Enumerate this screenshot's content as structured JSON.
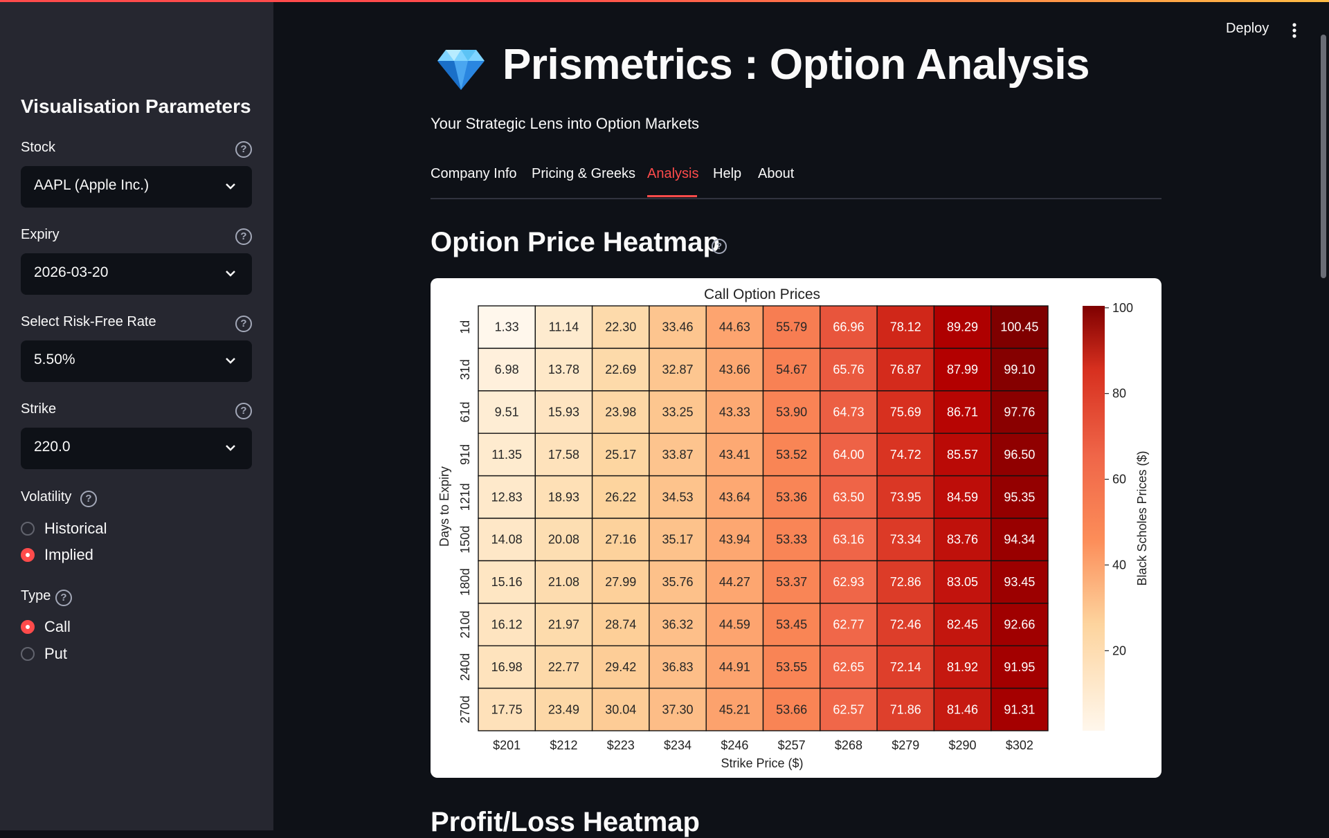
{
  "sidebar": {
    "title": "Visualisation Parameters",
    "stock": {
      "label": "Stock",
      "value": "AAPL (Apple Inc.)"
    },
    "expiry": {
      "label": "Expiry",
      "value": "2026-03-20"
    },
    "risk_free": {
      "label": "Select Risk-Free Rate",
      "value": "5.50%"
    },
    "strike": {
      "label": "Strike",
      "value": "220.0"
    },
    "volatility": {
      "label": "Volatility",
      "options": [
        "Historical",
        "Implied"
      ],
      "selected": "Implied"
    },
    "type": {
      "label": "Type",
      "options": [
        "Call",
        "Put"
      ],
      "selected": "Call"
    }
  },
  "header": {
    "deploy": "Deploy"
  },
  "main": {
    "title": "Prismetrics : Option Analysis",
    "subtitle": "Your Strategic Lens into Option Markets",
    "tabs": [
      {
        "label": "Company Info"
      },
      {
        "label": "Pricing & Greeks"
      },
      {
        "label": "Analysis"
      },
      {
        "label": "Help"
      },
      {
        "label": "About"
      }
    ],
    "active_tab": "Analysis",
    "section1_title": "Option Price Heatmap",
    "section2_title": "Profit/Loss Heatmap"
  },
  "colors": {
    "accent": "#ff4b4b",
    "sidebar_bg": "#262730",
    "main_bg": "#0e1117"
  },
  "icons": {
    "logo": "gem-icon",
    "help": "question-circle-icon",
    "select": "chevron-down-icon",
    "menu": "kebab-menu-icon"
  },
  "chart_data": {
    "type": "heatmap",
    "title": "Call Option Prices",
    "xlabel": "Strike Price ($)",
    "ylabel": "Days to Expiry",
    "colorbar_label": "Black Scholes Prices ($)",
    "colorbar_ticks": [
      20,
      40,
      60,
      80,
      100
    ],
    "colorbar_range": [
      1.33,
      100.45
    ],
    "colormap": "OrRd",
    "x": [
      "$201",
      "$212",
      "$223",
      "$234",
      "$246",
      "$257",
      "$268",
      "$279",
      "$290",
      "$302"
    ],
    "y": [
      "1d",
      "31d",
      "61d",
      "91d",
      "121d",
      "150d",
      "180d",
      "210d",
      "240d",
      "270d"
    ],
    "values": [
      [
        1.33,
        11.14,
        22.3,
        33.46,
        44.63,
        55.79,
        66.96,
        78.12,
        89.29,
        100.45
      ],
      [
        6.98,
        13.78,
        22.69,
        32.87,
        43.66,
        54.67,
        65.76,
        76.87,
        87.99,
        99.1
      ],
      [
        9.51,
        15.93,
        23.98,
        33.25,
        43.33,
        53.9,
        64.73,
        75.69,
        86.71,
        97.76
      ],
      [
        11.35,
        17.58,
        25.17,
        33.87,
        43.41,
        53.52,
        64.0,
        74.72,
        85.57,
        96.5
      ],
      [
        12.83,
        18.93,
        26.22,
        34.53,
        43.64,
        53.36,
        63.5,
        73.95,
        84.59,
        95.35
      ],
      [
        14.08,
        20.08,
        27.16,
        35.17,
        43.94,
        53.33,
        63.16,
        73.34,
        83.76,
        94.34
      ],
      [
        15.16,
        21.08,
        27.99,
        35.76,
        44.27,
        53.37,
        62.93,
        72.86,
        83.05,
        93.45
      ],
      [
        16.12,
        21.97,
        28.74,
        36.32,
        44.59,
        53.45,
        62.77,
        72.46,
        82.45,
        92.66
      ],
      [
        16.98,
        22.77,
        29.42,
        36.83,
        44.91,
        53.55,
        62.65,
        72.14,
        81.92,
        91.95
      ],
      [
        17.75,
        23.49,
        30.04,
        37.3,
        45.21,
        53.66,
        62.57,
        71.86,
        81.46,
        91.31
      ]
    ]
  }
}
